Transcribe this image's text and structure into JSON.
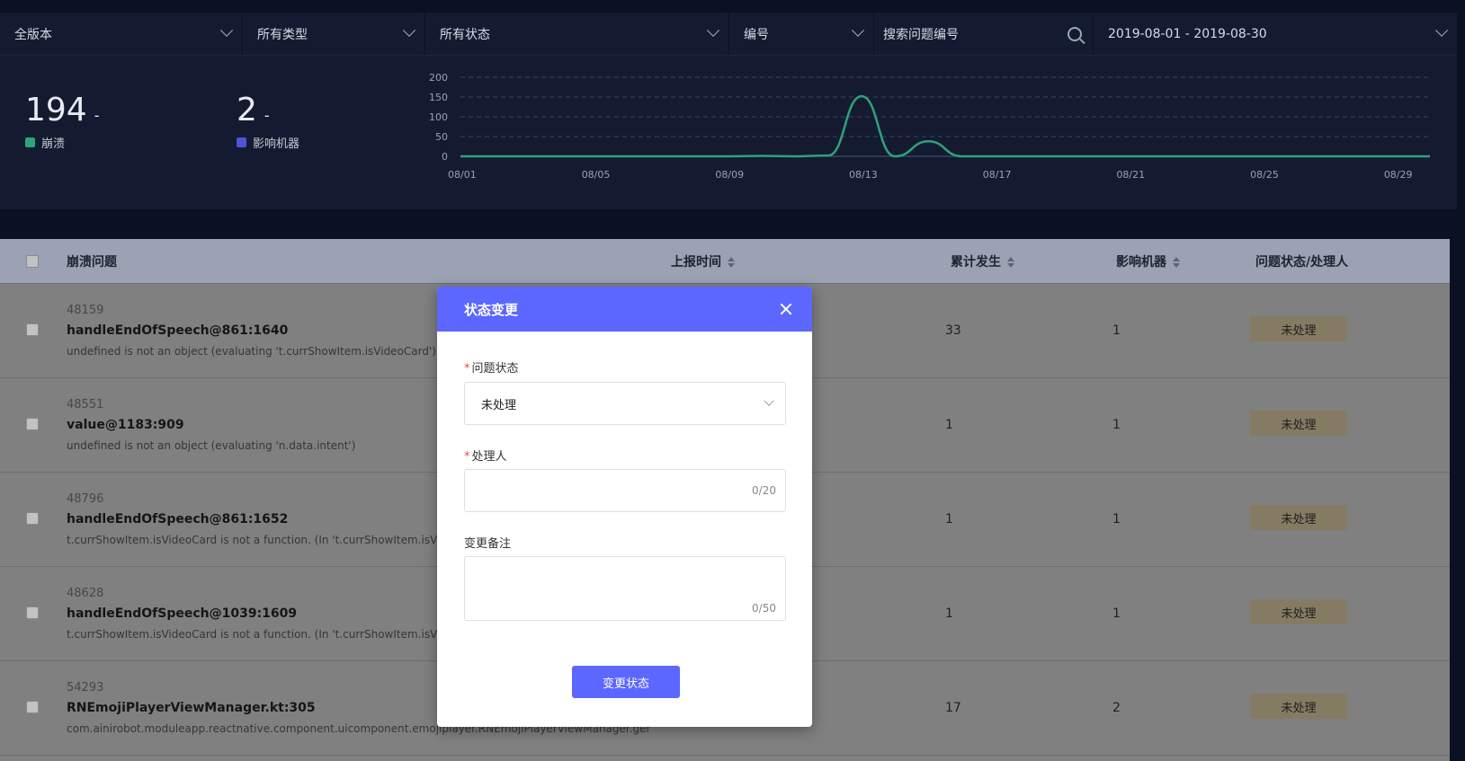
{
  "filters": {
    "version": "全版本",
    "type": "所有类型",
    "status": "所有状态",
    "id_type": "编号",
    "search_placeholder": "搜索问题编号",
    "date_range": "2019-08-01 - 2019-08-30"
  },
  "stats": {
    "crash_count": "194",
    "crash_dash": "-",
    "crash_label": "崩溃",
    "machines_count": "2",
    "machines_dash": "-",
    "machines_label": "影响机器",
    "crash_color": "#2fa27a",
    "machines_color": "#4b55d6"
  },
  "chart_data": {
    "type": "line",
    "x": [
      "08/01",
      "08/02",
      "08/03",
      "08/04",
      "08/05",
      "08/06",
      "08/07",
      "08/08",
      "08/09",
      "08/10",
      "08/11",
      "08/12",
      "08/13",
      "08/14",
      "08/15",
      "08/16",
      "08/17",
      "08/18",
      "08/19",
      "08/20",
      "08/21",
      "08/22",
      "08/23",
      "08/24",
      "08/25",
      "08/26",
      "08/27",
      "08/28",
      "08/29",
      "08/30"
    ],
    "x_ticks": [
      "08/01",
      "08/05",
      "08/09",
      "08/13",
      "08/17",
      "08/21",
      "08/25",
      "08/29"
    ],
    "series": [
      {
        "values": [
          0,
          0,
          0,
          0,
          0,
          0,
          0,
          0,
          0,
          1,
          0,
          2,
          152,
          0,
          38,
          0,
          0,
          0,
          0,
          0,
          0,
          0,
          0,
          0,
          0,
          0,
          0,
          0,
          0,
          0
        ]
      }
    ],
    "y_ticks": [
      "200",
      "150",
      "100",
      "50",
      "0"
    ],
    "ylim": [
      0,
      200
    ],
    "grid": true,
    "line_color": "#2fa27a"
  },
  "table": {
    "headers": {
      "issue": "崩溃问题",
      "time": "上报时间",
      "count": "累计发生",
      "machines": "影响机器",
      "status": "问题状态/处理人"
    },
    "rows": [
      {
        "id": "48159",
        "name": "handleEndOfSpeech@861:1640",
        "message": "undefined is not an object (evaluating 't.currShowItem.isVideoCard')",
        "count": "33",
        "machines": "1",
        "status": "未处理"
      },
      {
        "id": "48551",
        "name": "value@1183:909",
        "message": "undefined is not an object (evaluating 'n.data.intent')",
        "count": "1",
        "machines": "1",
        "status": "未处理"
      },
      {
        "id": "48796",
        "name": "handleEndOfSpeech@861:1652",
        "message": "t.currShowItem.isVideoCard is not a function. (In 't.currShowItem.isVide",
        "count": "1",
        "machines": "1",
        "status": "未处理"
      },
      {
        "id": "48628",
        "name": "handleEndOfSpeech@1039:1609",
        "message": "t.currShowItem.isVideoCard is not a function. (In 't.currShowItem.isVide",
        "count": "1",
        "machines": "1",
        "status": "未处理"
      },
      {
        "id": "54293",
        "name": "RNEmojiPlayerViewManager.kt:305",
        "message": "com.ainirobot.moduleapp.reactnative.component.uicomponent.emojiplayer.RNEmojiPlayerViewManager.generateE",
        "count": "17",
        "machines": "2",
        "status": "未处理"
      }
    ]
  },
  "modal": {
    "title": "状态变更",
    "status_label": "问题状态",
    "status_value": "未处理",
    "handler_label": "处理人",
    "handler_counter": "0/20",
    "note_label": "变更备注",
    "note_counter": "0/50",
    "submit_label": "变更状态",
    "required_mark": "*"
  }
}
